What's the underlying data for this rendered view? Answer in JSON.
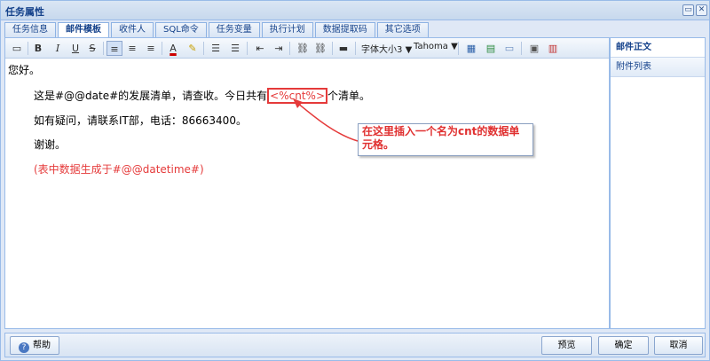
{
  "window": {
    "title": "任务属性"
  },
  "tabs": [
    {
      "label": "任务信息",
      "active": false
    },
    {
      "label": "邮件模板",
      "active": true
    },
    {
      "label": "收件人",
      "active": false
    },
    {
      "label": "SQL命令",
      "active": false
    },
    {
      "label": "任务变量",
      "active": false
    },
    {
      "label": "执行计划",
      "active": false
    },
    {
      "label": "数据提取码",
      "active": false
    },
    {
      "label": "其它选项",
      "active": false
    }
  ],
  "toolbar": {
    "bold": "B",
    "italic": "I",
    "underline": "U",
    "strike": "S",
    "font_color": "A",
    "font_size": "字体大小3",
    "font_family": "Tahoma"
  },
  "body": {
    "greeting": "您好。",
    "line1_before": "这是#@@date#的发展清单，请查收。今日共有",
    "line1_placeholder": "<%cnt%>",
    "line1_after": "个清单。",
    "line2": "如有疑问，请联系IT部，电话：86663400。",
    "line3": "谢谢。",
    "line4": "(表中数据生成于#@@datetime#)"
  },
  "callout": {
    "text": "在这里插入一个名为cnt的数据单元格。"
  },
  "side_panel": [
    {
      "label": "邮件正文",
      "active": true
    },
    {
      "label": "附件列表",
      "active": false
    }
  ],
  "buttons": {
    "help": "帮助",
    "preview": "预览",
    "ok": "确定",
    "cancel": "取消"
  },
  "colors": {
    "accent": "#15428b",
    "highlight": "#e53a3a"
  }
}
